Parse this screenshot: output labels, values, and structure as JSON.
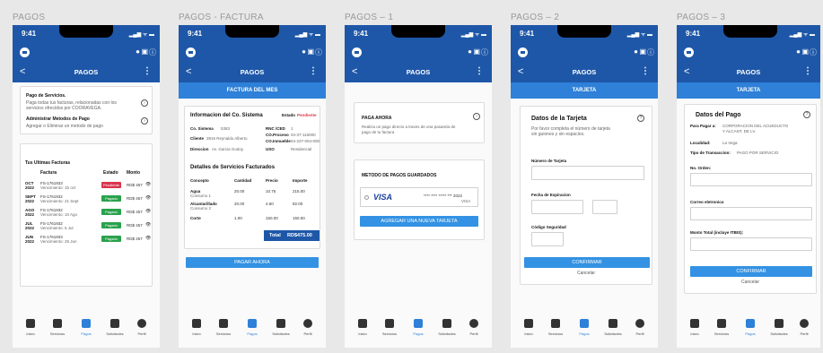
{
  "frames": [
    "PAGOS",
    "PAGOS - FACTURA",
    "PAGOS – 1",
    "PAGOS – 2",
    "PAGOS – 3"
  ],
  "status": {
    "time": "9:41",
    "signal": "▂▄▆ ᯤ ▬"
  },
  "nav": {
    "title": "PAGOS",
    "back": "<",
    "more": "⋮",
    "menu_icon": "menu-icon",
    "avatar_icon": "avatar-icon",
    "card_icon": "card-icon",
    "help_icon": "help-icon"
  },
  "help": "?",
  "tabs": [
    "Inicio",
    "Servicios",
    "Pagos",
    "Solicitudes",
    "Perfil"
  ],
  "screen0": {
    "pay_title": "Pago de Servicios.",
    "pay_desc1": "Paga todas tus facturas, relacionadas con los",
    "pay_desc2": "servicios ofrecidos por COORAVEGA.",
    "admin_title": "Administrar Metodos de Pago",
    "admin_desc": "Agregar o Eliminar un metodo de pago",
    "arrow": "›",
    "inv_title": "Tus Ultimas Facturas",
    "h_factura": "Factura",
    "h_estado": "Estado",
    "h_monto": "Monto",
    "rows": [
      {
        "m": "OCT",
        "y": "2022",
        "n": "FS-1761933",
        "v": "Vencimiento: 15 oct",
        "s": "Pendiente",
        "a": "RD$ 457"
      },
      {
        "m": "SEPT",
        "y": "2022",
        "n": "FS-1761932",
        "v": "Vencimiento: 21 Sept",
        "s": "Pagado",
        "a": "RD$ 457"
      },
      {
        "m": "AGO",
        "y": "2022",
        "n": "FS-1761932",
        "v": "Vencimiento: 10 Ago",
        "s": "Pagado",
        "a": "RD$ 457"
      },
      {
        "m": "JUL",
        "y": "2022",
        "n": "FS-1761932",
        "v": "Vencimiento: 5 Jul",
        "s": "Pagado",
        "a": "RD$ 457"
      },
      {
        "m": "JUN",
        "y": "2022",
        "n": "FS-1761933",
        "v": "Vencimiento: 25 Jun",
        "s": "Pagado",
        "a": "RD$ 457"
      }
    ],
    "eye": "👁"
  },
  "screen1": {
    "band": "FACTURA DEL MES",
    "info_title": "Informacion del Co. Sistema",
    "estado_lbl": "Estado",
    "estado_val": "Pendiente",
    "sistema_lbl": "Co. Sistema",
    "sistema_val": "5383",
    "rnc_lbl": "RNC /CED",
    "rnc_val": "1",
    "cliente_lbl": "Cliente",
    "cliente_val": "3916 Reynaldo Alberto",
    "proceso_lbl": "CO.Proceso",
    "proceso_val": "04-37-116000",
    "inmueble_lbl": "CO.Inmueble",
    "inmueble_val": "04-237-004-000",
    "dir_lbl": "Direccion",
    "dir_val": "Av. Garcia Godoy",
    "uso_lbl": "USO",
    "uso_val": "Residencial",
    "det_title": "Detalles de Servicios Facturados",
    "cols": [
      "Concepto",
      "Cantidad",
      "Precio",
      "Importe"
    ],
    "items": [
      {
        "c1": "Agua",
        "c2": "Consumo 1",
        "q": "20.00",
        "p": "10.75",
        "i": "215.00"
      },
      {
        "c1": "Alcantarillado",
        "c2": "Consumo 2",
        "q": "20.00",
        "p": "4.60",
        "i": "92.00"
      },
      {
        "c1": "Corte",
        "c2": "",
        "q": "1.00",
        "p": "150.00",
        "i": "150.00"
      }
    ],
    "total_lbl": "Total",
    "total_val": "RD$475.00",
    "pay_btn": "PAGAR AHORA"
  },
  "screen2": {
    "paga_title": "PAGA AHORA",
    "paga_desc1": "Realiza un pago directo a traves de una pasarela de",
    "paga_desc2": "pago de tu factura",
    "metodo_title": "METODO DE PAGOS GUARDADOS",
    "visa": "VISA",
    "card_num": "**** **** ***** *** 2022",
    "card_brand": "VISA",
    "add_btn": "AGREGAR UNA NUEVA TARJETA"
  },
  "screen3": {
    "band": "TARJETA",
    "title": "Datos de la Tarjeta",
    "desc1": "Por favor completa el número de tarjeta",
    "desc2": "sin guiones y sin espacios.",
    "num_lbl": "Número de Tarjeta",
    "exp_lbl": "Fecha de Expiracion",
    "cvv_lbl": "Código Seguridad",
    "confirm": "CONFIRMAR",
    "cancel": "Cancelar"
  },
  "screen4": {
    "band": "TARJETA",
    "title": "Datos del Pago",
    "para_lbl": "Para Pagar a:",
    "para_val1": "CORPORACION DEL ACUEDUCTO",
    "para_val2": "Y ALCANT. DE LV.",
    "loc_lbl": "Localidad:",
    "loc_val": "La Vega",
    "tipo_lbl": "Tipo de Transaccion:",
    "tipo_val": "PAGO POR SERVICIO",
    "orden_lbl": "No. Orden:",
    "correo_lbl": "Correo eletronico",
    "monto_lbl": "Monto Total (incluye ITBIS):",
    "confirm": "CONFIRMAR",
    "cancel": "Cancelar"
  },
  "colors": {
    "primary": "#1e57a8",
    "accent": "#2e80d8",
    "pending": "#d9354a",
    "paid": "#2aa14e"
  }
}
